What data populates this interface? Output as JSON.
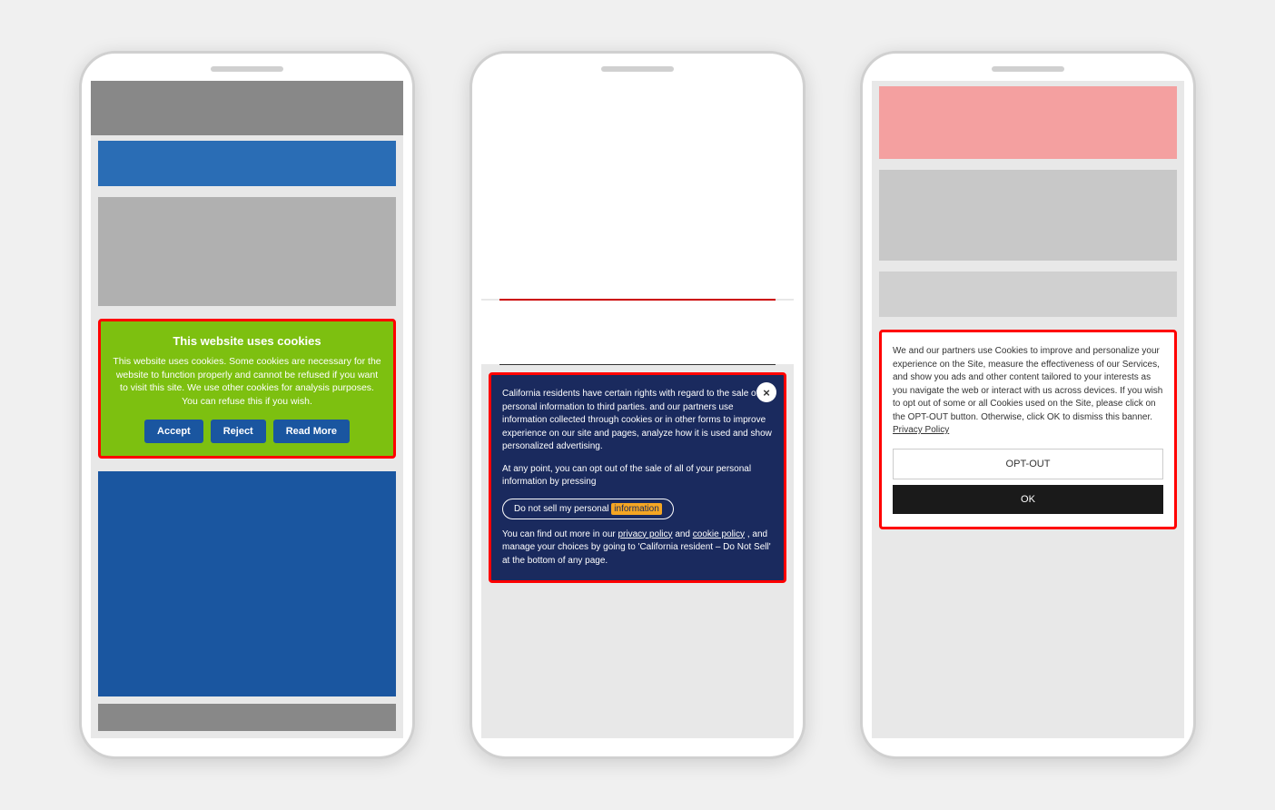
{
  "phone1": {
    "cookie_banner": {
      "title": "This website uses cookies",
      "text": "This website uses cookies. Some cookies are necessary for the website to function properly and cannot be refused if you want to visit this site. We use other cookies for analysis purposes. You can refuse this if you wish.",
      "btn_accept": "Accept",
      "btn_reject": "Reject",
      "btn_read_more": "Read More"
    }
  },
  "phone2": {
    "cookie_banner": {
      "close_icon": "×",
      "text1": "California residents have certain rights with regard to the sale of personal information to third parties.",
      "text1b": "and our partners use information collected through cookies or in other forms to improve experience on our site and pages, analyze how it is used and show personalized advertising.",
      "text2": "At any point, you can opt out of the sale of all of your personal information by pressing",
      "opt_out_label": "Do not sell my personal information",
      "opt_out_highlight": "information",
      "text3": "You can find out more in our",
      "link1": "privacy policy",
      "text3b": "and",
      "link2": "cookie policy",
      "text3c": ", and manage your choices by going to 'California resident – Do Not Sell' at the bottom of any page."
    }
  },
  "phone3": {
    "cookie_banner": {
      "text": "We and our partners use Cookies to improve and personalize your experience on the Site, measure the effectiveness of our Services, and show you ads and other content tailored to your interests as you navigate the web or interact with us across devices. If you wish to opt out of some or all Cookies used on the Site, please click on the OPT-OUT button. Otherwise, click OK to dismiss this banner.",
      "link_label": "Privacy Policy",
      "btn_opt_out": "OPT-OUT",
      "btn_ok": "OK"
    }
  }
}
